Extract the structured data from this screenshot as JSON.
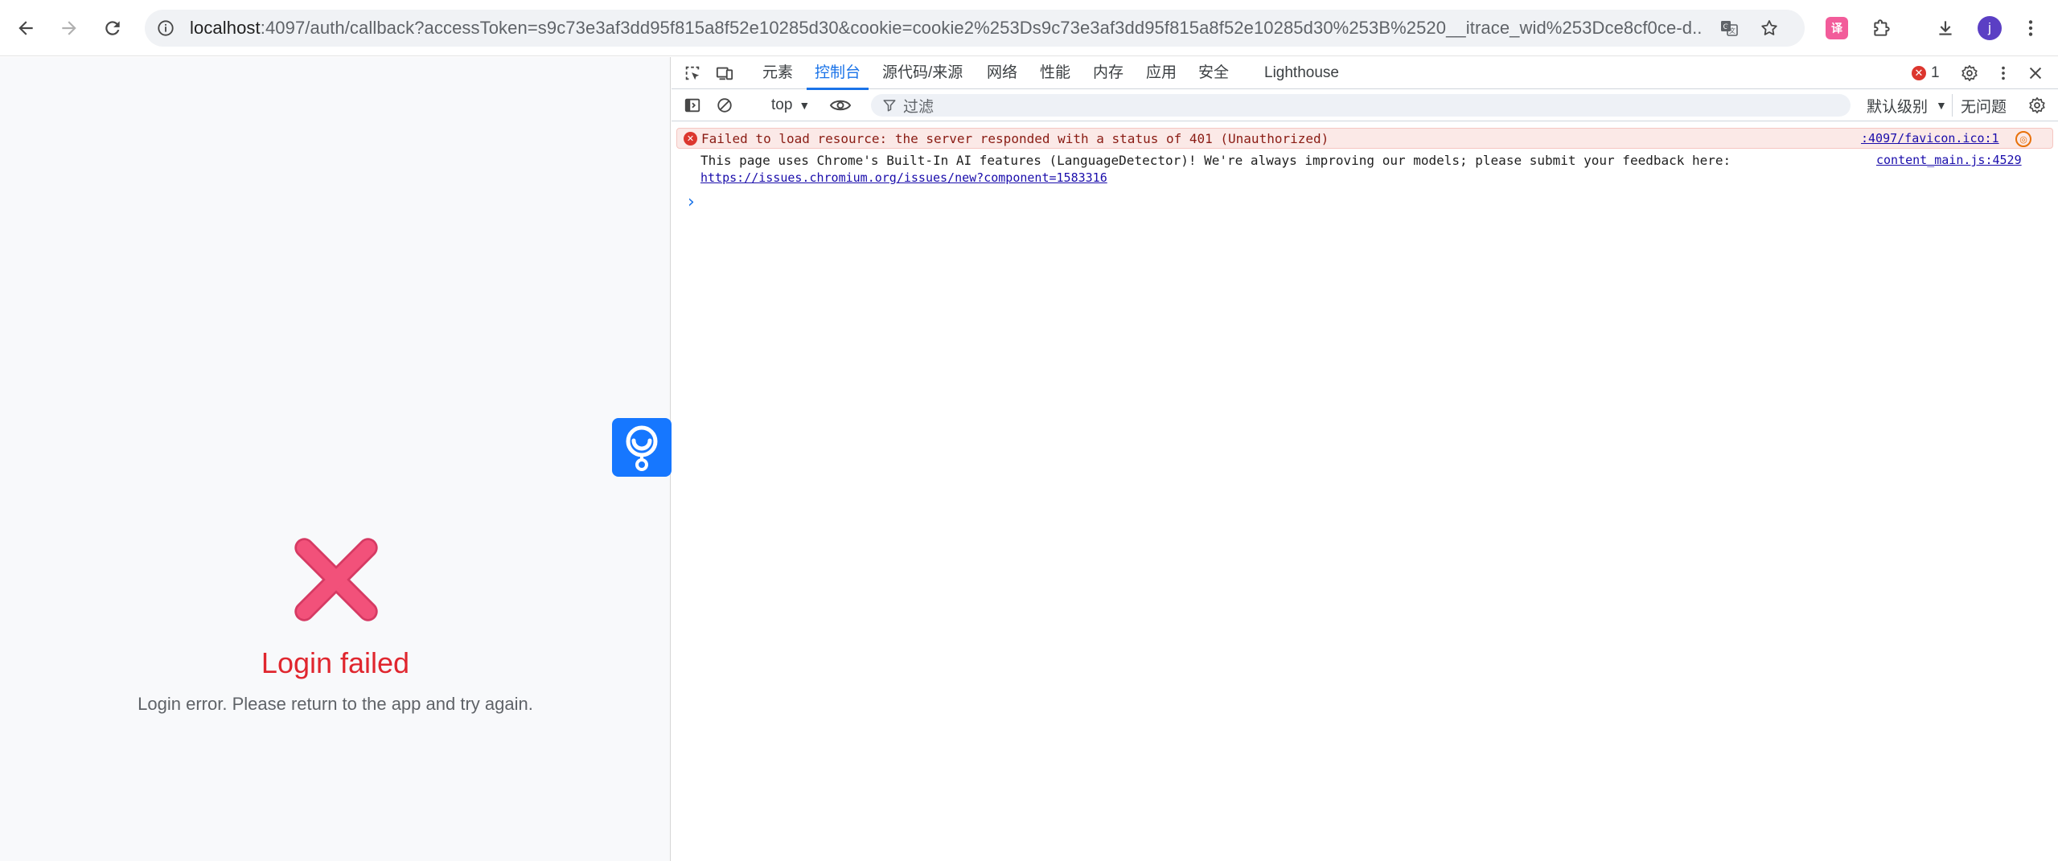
{
  "browser": {
    "url_host": "localhost",
    "url_rest": ":4097/auth/callback?accessToken=s9c73e3af3dd95f815a8f52e10285d30&cookie=cookie2%253Ds9c73e3af3dd95f815a8f52e10285d30%253B%2520__itrace_wid%253Dce8cf0ce-d...",
    "profile_initial": "j",
    "extension_label": "译"
  },
  "page": {
    "title": "Login failed",
    "message": "Login error. Please return to the app and try again.",
    "error_color": "#e0262e",
    "icon_color": "#f2517a"
  },
  "devtools": {
    "tabs": [
      "元素",
      "控制台",
      "源代码/来源",
      "网络",
      "性能",
      "内存",
      "应用",
      "安全",
      "Lighthouse"
    ],
    "active_tab": "控制台",
    "error_count": "1",
    "context": "top",
    "filter_placeholder": "过滤",
    "level": "默认级别",
    "issues": "无问题",
    "console": {
      "error_message": "Failed to load resource: the server responded with a status of 401 (Unauthorized)",
      "error_source": ":4097/favicon.ico:1",
      "info_message": "This page uses Chrome's Built-In AI features (LanguageDetector)! We're always improving our models; please submit your feedback here:",
      "info_link": "https://issues.chromium.org/issues/new?component=1583316",
      "info_source": "content_main.js:4529",
      "prompt": "›"
    }
  }
}
